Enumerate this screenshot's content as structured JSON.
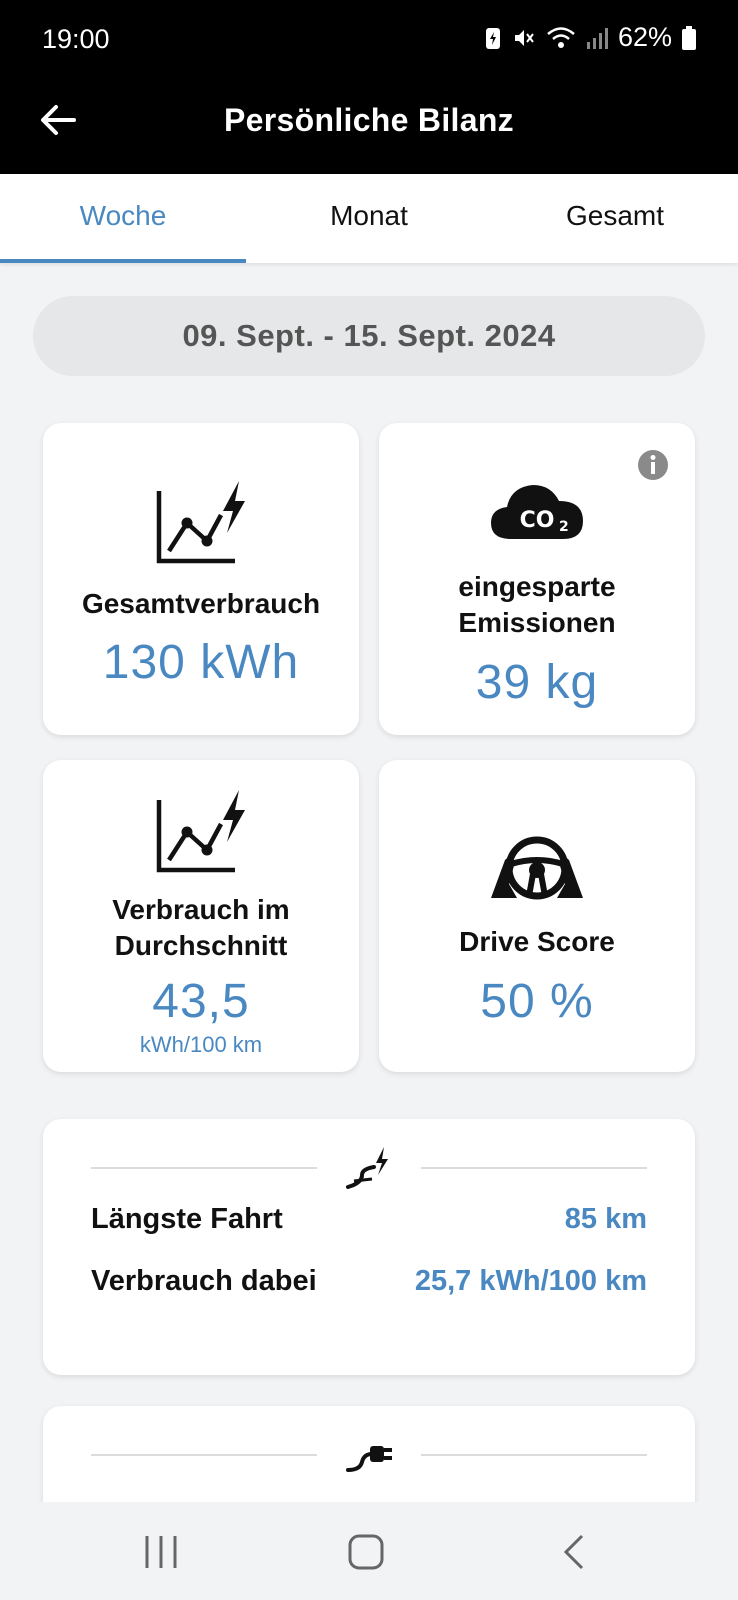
{
  "status_bar": {
    "time": "19:00",
    "battery": "62%"
  },
  "header": {
    "title": "Persönliche Bilanz"
  },
  "tabs": [
    {
      "label": "Woche",
      "active": true
    },
    {
      "label": "Monat",
      "active": false
    },
    {
      "label": "Gesamt",
      "active": false
    }
  ],
  "date_range": "09. Sept. - 15. Sept. 2024",
  "stats": {
    "total_consumption": {
      "label": "Gesamtverbrauch",
      "value": "130 kWh",
      "icon": "consumption-chart-icon"
    },
    "saved_emissions": {
      "label_line1": "eingesparte",
      "label_line2": "Emissionen",
      "value": "39 kg",
      "icon": "co2-cloud-icon"
    },
    "avg_consumption": {
      "label_line1": "Verbrauch im",
      "label_line2": "Durchschnitt",
      "value": "43,5",
      "unit": "kWh/100 km",
      "icon": "consumption-chart-icon"
    },
    "drive_score": {
      "label": "Drive Score",
      "value": "50 %",
      "icon": "steering-wheel-icon"
    }
  },
  "longest_trip": {
    "icon": "road-lightning-icon",
    "rows": [
      {
        "label": "Längste Fahrt",
        "value": "85 km"
      },
      {
        "label": "Verbrauch dabei",
        "value": "25,7 kWh/100 km"
      }
    ]
  },
  "charging_card": {
    "icon": "charging-plug-icon"
  },
  "colors": {
    "accent": "#4a88c2",
    "header_bg": "#000000",
    "page_bg": "#f2f3f5"
  }
}
